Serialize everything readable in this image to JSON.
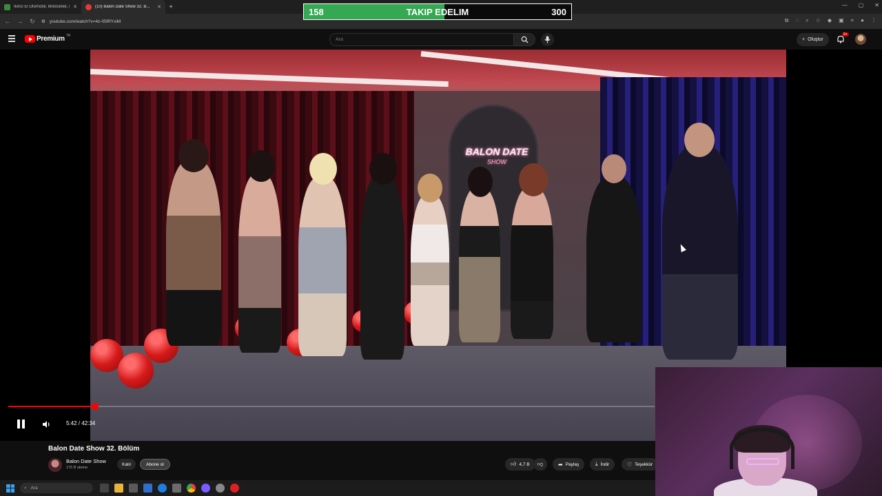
{
  "browser": {
    "tabs": [
      {
        "title": "İkinci El Otomobil, Motosiklet, İ...",
        "active": false
      },
      {
        "title": "(10) Balon Date Show 32. B...",
        "active": true
      }
    ],
    "url": "youtube.com/watch?v=4z-05lRYxiM"
  },
  "overlay": {
    "current": "158",
    "label": "TAKIP EDELIM",
    "goal": "300",
    "progress": 0.527
  },
  "header": {
    "logo_text": "Premium",
    "logo_sup": "TR",
    "search_placeholder": "Ara",
    "create_label": "Oluştur",
    "notif_badge": "9+"
  },
  "player": {
    "time": "5:42 / 42:34",
    "progress": 0.134
  },
  "video": {
    "neon_line1": "BALON DATE",
    "neon_line2": "SHOW"
  },
  "below": {
    "title": "Balon Date Show 32. Bölüm",
    "channel": "Balon Date Show",
    "subs": "175 B abone",
    "join_label": "Katıl",
    "subscribe_label": "Abone ol",
    "like_count": "4,7 B",
    "share_label": "Paylaş",
    "download_label": "İndir",
    "thanks_label": "Teşekkür"
  },
  "taskbar": {
    "search_label": "Ara"
  },
  "colors": {
    "accent": "#ff0000",
    "overlay_fill": "#35a853",
    "background": "#0f0f0f"
  }
}
